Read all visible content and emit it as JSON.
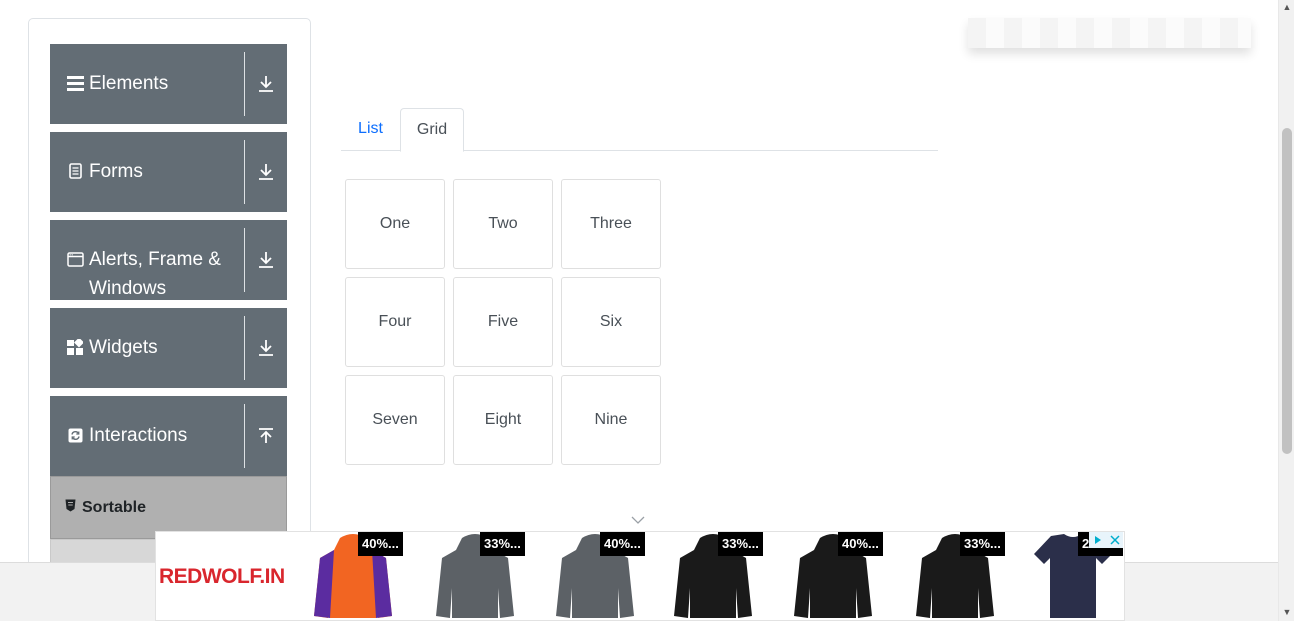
{
  "sidebar": {
    "groups": [
      {
        "title": "Elements",
        "icon": "list-icon",
        "toggle": "download-arrow-icon"
      },
      {
        "title": "Forms",
        "icon": "document-icon",
        "toggle": "download-arrow-icon"
      },
      {
        "title": "Alerts, Frame & Windows",
        "icon": "window-icon",
        "toggle": "download-arrow-icon"
      },
      {
        "title": "Widgets",
        "icon": "widgets-icon",
        "toggle": "download-arrow-icon"
      },
      {
        "title": "Interactions",
        "icon": "refresh-icon",
        "toggle": "upload-arrow-icon"
      }
    ],
    "active_item": {
      "label": "Sortable",
      "icon": "shield-icon"
    }
  },
  "tabs": [
    {
      "label": "List",
      "active": false
    },
    {
      "label": "Grid",
      "active": true
    }
  ],
  "grid": [
    "One",
    "Two",
    "Three",
    "Four",
    "Five",
    "Six",
    "Seven",
    "Eight",
    "Nine"
  ],
  "ad": {
    "brand": "REDWOLF.IN",
    "products": [
      {
        "discount": "40%...",
        "color": "#f26522",
        "kind": "jacket"
      },
      {
        "discount": "33%...",
        "color": "#5c6166",
        "kind": "hoodie"
      },
      {
        "discount": "40%...",
        "color": "#5c6166",
        "kind": "hoodie"
      },
      {
        "discount": "33%...",
        "color": "#1a1a1a",
        "kind": "hoodie"
      },
      {
        "discount": "40%...",
        "color": "#1a1a1a",
        "kind": "hoodie"
      },
      {
        "discount": "33%...",
        "color": "#1a1a1a",
        "kind": "hoodie"
      },
      {
        "discount": "25%...",
        "color": "#2b2f4a",
        "kind": "tshirt"
      }
    ]
  },
  "colors": {
    "sidebar_header": "#636d75",
    "tab_active_text": "#495057",
    "tab_link": "#0d6efd"
  }
}
